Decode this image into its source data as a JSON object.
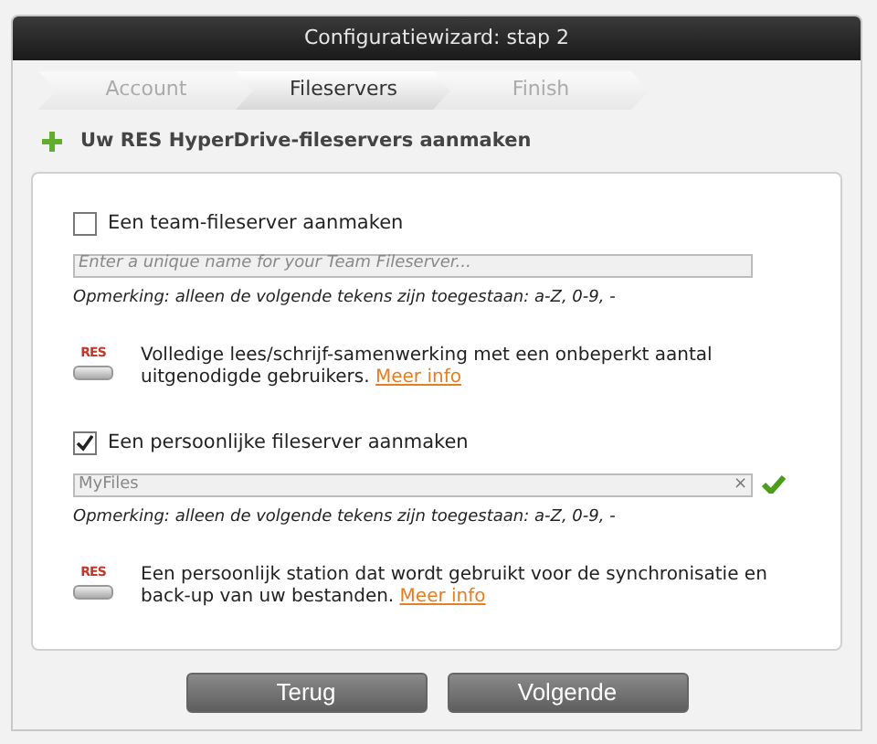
{
  "window": {
    "title": "Configuratiewizard: stap 2"
  },
  "steps": [
    {
      "label": "Account",
      "selected": false
    },
    {
      "label": "Fileservers",
      "selected": true
    },
    {
      "label": "Finish",
      "selected": false
    }
  ],
  "heading": "Uw RES HyperDrive-fileservers aanmaken",
  "sections": [
    {
      "label": "Een team-fileserver aanmaken",
      "checked": false,
      "field": {
        "placeholder": "Enter a unique name for your Team Fileserver...",
        "valid": false
      },
      "note": "Opmerking: alleen de volgende tekens zijn toegestaan: a-Z, 0-9, -",
      "description": "Volledige lees/schrijf-samenwerking met een onbeperkt aantal uitgenodigde gebruikers.",
      "link": "Meer info",
      "icon_text": "RES"
    },
    {
      "label": "Een persoonlijke fileserver aanmaken",
      "checked": true,
      "field": {
        "value": "MyFiles",
        "clear": "×",
        "valid": true
      },
      "note": "Opmerking: alleen de volgende tekens zijn toegestaan: a-Z, 0-9, -",
      "description": "Een persoonlijk station dat wordt gebruikt voor de synchronisatie en back-up van uw bestanden.",
      "link": "Meer info",
      "icon_text": "RES"
    }
  ],
  "buttons": [
    "Terug",
    "Volgende"
  ]
}
